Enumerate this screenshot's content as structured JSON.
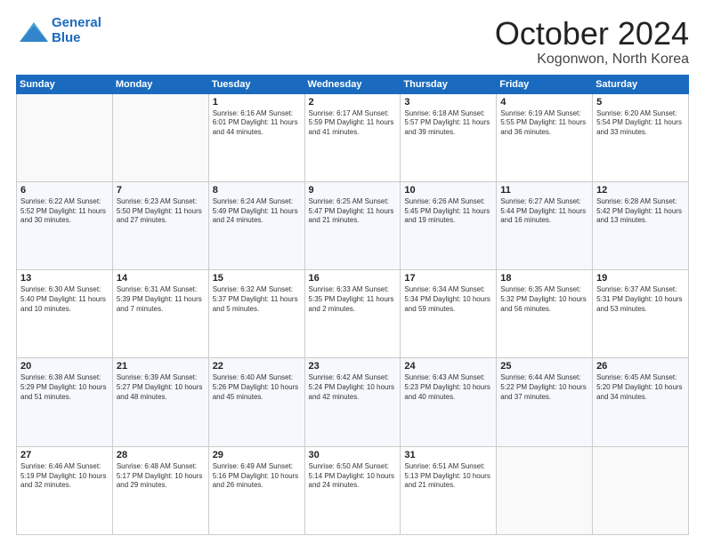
{
  "header": {
    "logo_line1": "General",
    "logo_line2": "Blue",
    "month": "October 2024",
    "location": "Kogonwon, North Korea"
  },
  "weekdays": [
    "Sunday",
    "Monday",
    "Tuesday",
    "Wednesday",
    "Thursday",
    "Friday",
    "Saturday"
  ],
  "weeks": [
    [
      {
        "day": "",
        "info": ""
      },
      {
        "day": "",
        "info": ""
      },
      {
        "day": "1",
        "info": "Sunrise: 6:16 AM\nSunset: 6:01 PM\nDaylight: 11 hours and 44 minutes."
      },
      {
        "day": "2",
        "info": "Sunrise: 6:17 AM\nSunset: 5:59 PM\nDaylight: 11 hours and 41 minutes."
      },
      {
        "day": "3",
        "info": "Sunrise: 6:18 AM\nSunset: 5:57 PM\nDaylight: 11 hours and 39 minutes."
      },
      {
        "day": "4",
        "info": "Sunrise: 6:19 AM\nSunset: 5:55 PM\nDaylight: 11 hours and 36 minutes."
      },
      {
        "day": "5",
        "info": "Sunrise: 6:20 AM\nSunset: 5:54 PM\nDaylight: 11 hours and 33 minutes."
      }
    ],
    [
      {
        "day": "6",
        "info": "Sunrise: 6:22 AM\nSunset: 5:52 PM\nDaylight: 11 hours and 30 minutes."
      },
      {
        "day": "7",
        "info": "Sunrise: 6:23 AM\nSunset: 5:50 PM\nDaylight: 11 hours and 27 minutes."
      },
      {
        "day": "8",
        "info": "Sunrise: 6:24 AM\nSunset: 5:49 PM\nDaylight: 11 hours and 24 minutes."
      },
      {
        "day": "9",
        "info": "Sunrise: 6:25 AM\nSunset: 5:47 PM\nDaylight: 11 hours and 21 minutes."
      },
      {
        "day": "10",
        "info": "Sunrise: 6:26 AM\nSunset: 5:45 PM\nDaylight: 11 hours and 19 minutes."
      },
      {
        "day": "11",
        "info": "Sunrise: 6:27 AM\nSunset: 5:44 PM\nDaylight: 11 hours and 16 minutes."
      },
      {
        "day": "12",
        "info": "Sunrise: 6:28 AM\nSunset: 5:42 PM\nDaylight: 11 hours and 13 minutes."
      }
    ],
    [
      {
        "day": "13",
        "info": "Sunrise: 6:30 AM\nSunset: 5:40 PM\nDaylight: 11 hours and 10 minutes."
      },
      {
        "day": "14",
        "info": "Sunrise: 6:31 AM\nSunset: 5:39 PM\nDaylight: 11 hours and 7 minutes."
      },
      {
        "day": "15",
        "info": "Sunrise: 6:32 AM\nSunset: 5:37 PM\nDaylight: 11 hours and 5 minutes."
      },
      {
        "day": "16",
        "info": "Sunrise: 6:33 AM\nSunset: 5:35 PM\nDaylight: 11 hours and 2 minutes."
      },
      {
        "day": "17",
        "info": "Sunrise: 6:34 AM\nSunset: 5:34 PM\nDaylight: 10 hours and 59 minutes."
      },
      {
        "day": "18",
        "info": "Sunrise: 6:35 AM\nSunset: 5:32 PM\nDaylight: 10 hours and 56 minutes."
      },
      {
        "day": "19",
        "info": "Sunrise: 6:37 AM\nSunset: 5:31 PM\nDaylight: 10 hours and 53 minutes."
      }
    ],
    [
      {
        "day": "20",
        "info": "Sunrise: 6:38 AM\nSunset: 5:29 PM\nDaylight: 10 hours and 51 minutes."
      },
      {
        "day": "21",
        "info": "Sunrise: 6:39 AM\nSunset: 5:27 PM\nDaylight: 10 hours and 48 minutes."
      },
      {
        "day": "22",
        "info": "Sunrise: 6:40 AM\nSunset: 5:26 PM\nDaylight: 10 hours and 45 minutes."
      },
      {
        "day": "23",
        "info": "Sunrise: 6:42 AM\nSunset: 5:24 PM\nDaylight: 10 hours and 42 minutes."
      },
      {
        "day": "24",
        "info": "Sunrise: 6:43 AM\nSunset: 5:23 PM\nDaylight: 10 hours and 40 minutes."
      },
      {
        "day": "25",
        "info": "Sunrise: 6:44 AM\nSunset: 5:22 PM\nDaylight: 10 hours and 37 minutes."
      },
      {
        "day": "26",
        "info": "Sunrise: 6:45 AM\nSunset: 5:20 PM\nDaylight: 10 hours and 34 minutes."
      }
    ],
    [
      {
        "day": "27",
        "info": "Sunrise: 6:46 AM\nSunset: 5:19 PM\nDaylight: 10 hours and 32 minutes."
      },
      {
        "day": "28",
        "info": "Sunrise: 6:48 AM\nSunset: 5:17 PM\nDaylight: 10 hours and 29 minutes."
      },
      {
        "day": "29",
        "info": "Sunrise: 6:49 AM\nSunset: 5:16 PM\nDaylight: 10 hours and 26 minutes."
      },
      {
        "day": "30",
        "info": "Sunrise: 6:50 AM\nSunset: 5:14 PM\nDaylight: 10 hours and 24 minutes."
      },
      {
        "day": "31",
        "info": "Sunrise: 6:51 AM\nSunset: 5:13 PM\nDaylight: 10 hours and 21 minutes."
      },
      {
        "day": "",
        "info": ""
      },
      {
        "day": "",
        "info": ""
      }
    ]
  ]
}
